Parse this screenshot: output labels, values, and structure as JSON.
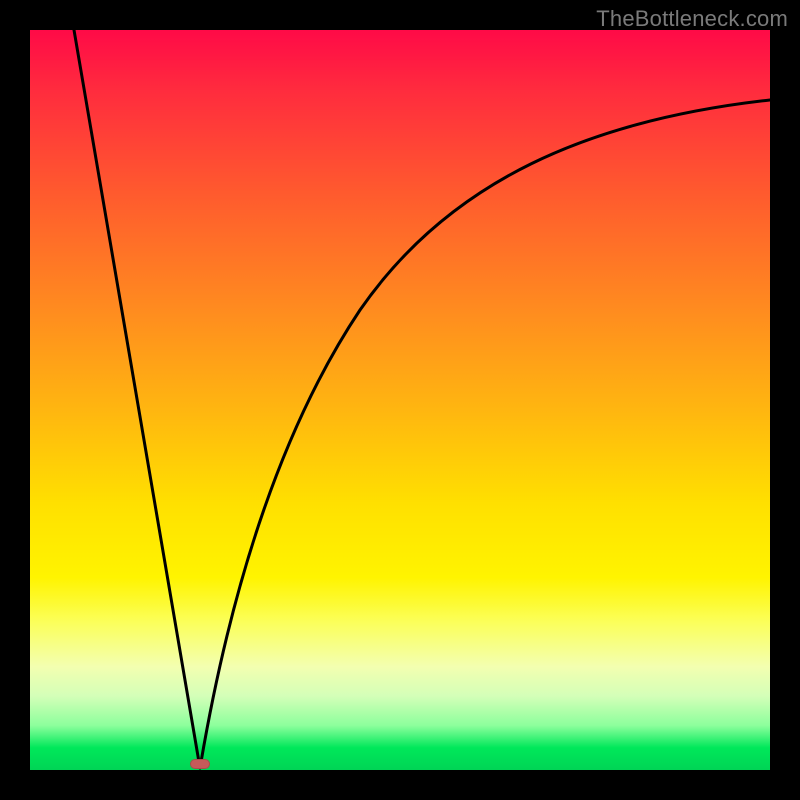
{
  "watermark": "TheBottleneck.com",
  "colors": {
    "frame": "#000000",
    "curve": "#000000",
    "marker": "#c65a5a",
    "gradient_top": "#ff0a47",
    "gradient_mid": "#ffe000",
    "gradient_bottom": "#00d455"
  },
  "chart_data": {
    "type": "line",
    "title": "",
    "xlabel": "",
    "ylabel": "",
    "xlim": [
      0,
      100
    ],
    "ylim": [
      0,
      100
    ],
    "grid": false,
    "legend": false,
    "annotations": [
      "TheBottleneck.com"
    ],
    "min_point": {
      "x": 23,
      "y": 0
    },
    "series": [
      {
        "name": "left-branch",
        "x": [
          6,
          10,
          14,
          18,
          21,
          23
        ],
        "values": [
          100,
          76,
          53,
          30,
          12,
          0
        ]
      },
      {
        "name": "right-branch",
        "x": [
          23,
          26,
          30,
          36,
          44,
          54,
          66,
          80,
          92,
          100
        ],
        "values": [
          0,
          15,
          33,
          50,
          63,
          73,
          80,
          85,
          88,
          90
        ]
      }
    ]
  }
}
